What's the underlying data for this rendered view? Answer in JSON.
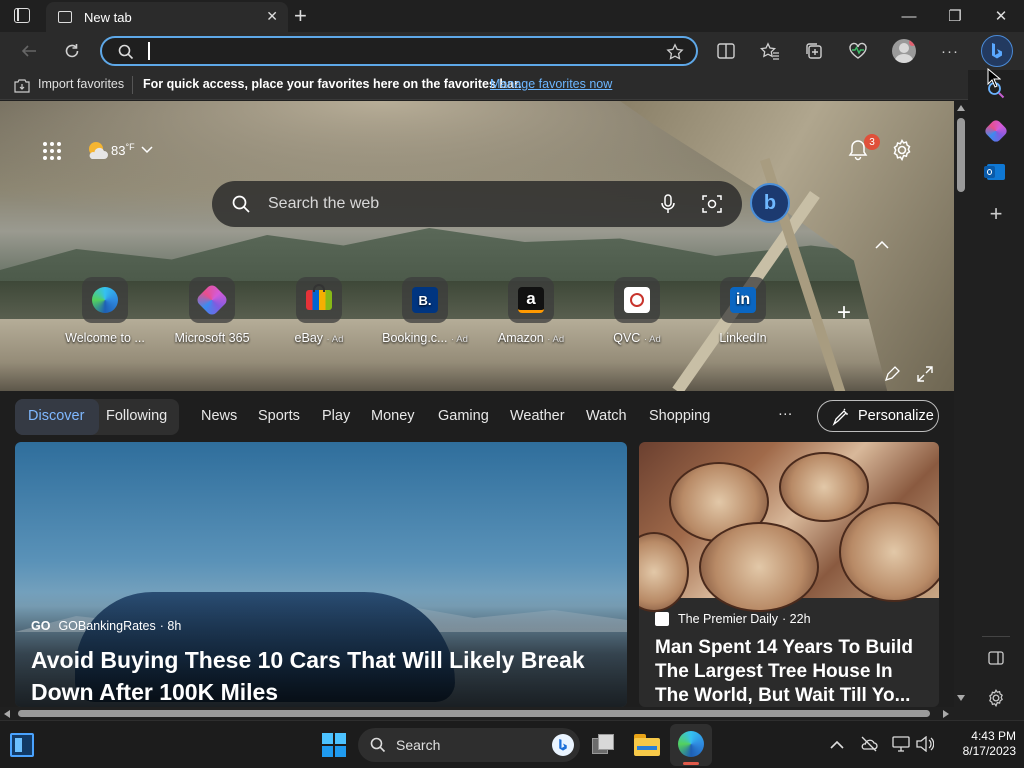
{
  "titlebar": {
    "tab_title": "New tab",
    "tab_close": "✕",
    "new_tab": "+",
    "minimize": "—",
    "restore": "❐",
    "close": "✕"
  },
  "toolbar": {
    "address_value": "",
    "more": "···"
  },
  "favorites_bar": {
    "import_label": "Import favorites",
    "message": "For quick access, place your favorites here on the favorites bar.",
    "manage_link": "Manage favorites now"
  },
  "hero": {
    "temperature": "83",
    "temp_unit": "°F",
    "notification_count": "3",
    "search_placeholder": "Search the web",
    "bing_letter": "b",
    "quick_links": [
      {
        "label": "Welcome to ...",
        "ad": "",
        "icon": "edge-icon"
      },
      {
        "label": "Microsoft 365",
        "ad": "",
        "icon": "m365-icon"
      },
      {
        "label": "eBay",
        "ad": "· Ad",
        "icon": "ebay-icon"
      },
      {
        "label": "Booking.c...",
        "ad": "· Ad",
        "icon": "booking-icon"
      },
      {
        "label": "Amazon",
        "ad": "· Ad",
        "icon": "amazon-icon"
      },
      {
        "label": "QVC",
        "ad": "· Ad",
        "icon": "qvc-icon"
      },
      {
        "label": "LinkedIn",
        "ad": "",
        "icon": "linkedin-icon"
      }
    ],
    "add_link": "+",
    "booking_letter": "B.",
    "amazon_letter": "a",
    "linkedin_letters": "in"
  },
  "nav": {
    "tabs": [
      "Discover",
      "Following",
      "News",
      "Sports",
      "Play",
      "Money",
      "Gaming",
      "Weather",
      "Watch",
      "Shopping"
    ],
    "more": "···",
    "personalize": "Personalize"
  },
  "cards": [
    {
      "source_logo": "GO",
      "source": "GOBankingRates",
      "age": "· 8h",
      "headline": "Avoid Buying These 10 Cars That Will Likely Break Down After 100K Miles"
    },
    {
      "source": "The Premier Daily",
      "age": "· 22h",
      "headline": "Man Spent 14 Years To Build The Largest Tree House In The World, But Wait Till Yo..."
    }
  ],
  "taskbar": {
    "search_label": "Search",
    "time": "4:43 PM",
    "date": "8/17/2023"
  },
  "colors": {
    "accent": "#5ea8e8",
    "discover": "#7fb8ff",
    "link": "#6cb6ff",
    "badge": "#e0503a"
  }
}
